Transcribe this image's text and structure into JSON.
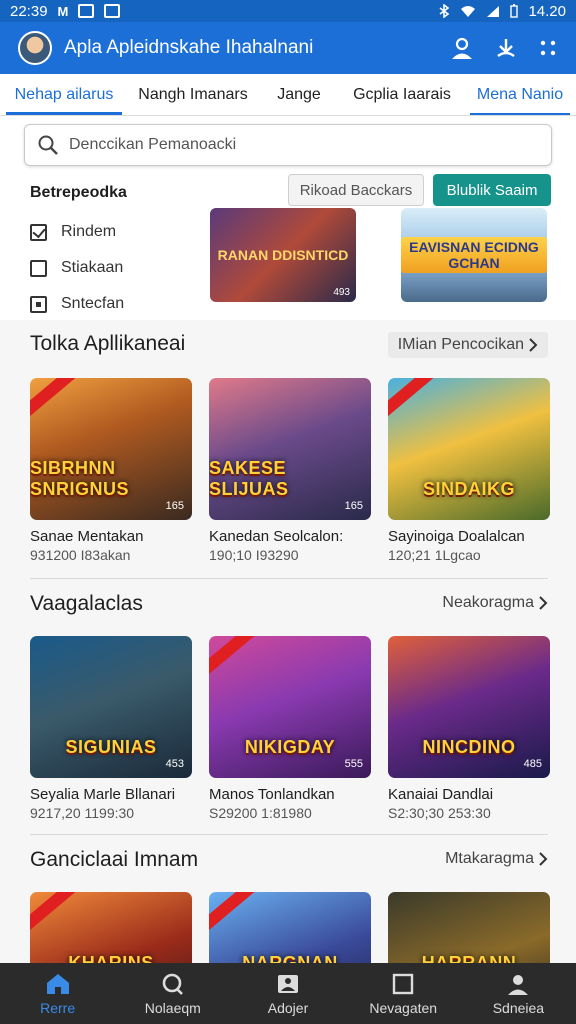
{
  "status_bar": {
    "time": "22:39",
    "left_icons": [
      "M",
      "photo-icon",
      "notification-icon"
    ],
    "right_time": "14.20"
  },
  "app_bar": {
    "title": "Apla Apleidnskahe Ihahalnani"
  },
  "tabs": [
    {
      "label": "Nehap ailarus",
      "active": true
    },
    {
      "label": "Nangh Imanars"
    },
    {
      "label": "Jange"
    },
    {
      "label": "Gcplia Iaarais"
    },
    {
      "label": "Mena Nanio"
    }
  ],
  "search": {
    "placeholder": "Denccikan Pemanoacki"
  },
  "filter": {
    "title": "Betrepeodka",
    "items": [
      {
        "label": "Rindem",
        "state": "checked"
      },
      {
        "label": "Stiakaan",
        "state": "unchecked"
      },
      {
        "label": "Sntecfan",
        "state": "indeterminate"
      }
    ],
    "secondary_button": "Rikoad Bacckars",
    "primary_button": "Blublik Saaim",
    "banners": [
      {
        "title": "RANAN DDISNTICD",
        "badge": "493"
      },
      {
        "title": "EAVISNAN ECIDNG GCHAN"
      }
    ]
  },
  "sections": [
    {
      "title": "Tolka Apllikaneai",
      "see_all": "IMian Pencocikan",
      "cards": [
        {
          "art": "SIBRHNN SNRIGNUS",
          "count": "165",
          "name": "Sanae Mentakan",
          "meta": "931200   I83akan"
        },
        {
          "art": "SAKESE SLIJUAS",
          "count": "165",
          "name": "Kanedan Seolcalon:",
          "meta": "190;10   I93290"
        },
        {
          "art": "SINDAIKG",
          "count": "",
          "name": "Sayinoiga Doalalcan",
          "meta": "120;21   1Lgcao"
        }
      ]
    },
    {
      "title": "Vaagalaclas",
      "see_all": "Neakoragma",
      "cards": [
        {
          "art": "SIGUNIAS",
          "count": "453",
          "name": "Seyalia Marle Bllanari",
          "meta": "9217,20   1199:30"
        },
        {
          "art": "NIKIGDAY",
          "count": "555",
          "name": "Manos Tonlandkan",
          "meta": "S29200   1:81980"
        },
        {
          "art": "NINCDINO",
          "count": "485",
          "name": "Kanaiai Dandlai",
          "meta": "S2:30;30   253:30"
        }
      ]
    },
    {
      "title": "Ganciclaai Imnam",
      "see_all": "Mtakaragma",
      "cards": [
        {
          "art": "KHARINS"
        },
        {
          "art": "NARGNAN"
        },
        {
          "art": "HARRANN"
        }
      ]
    }
  ],
  "bottom_nav": [
    {
      "label": "Rerre",
      "icon": "home-icon",
      "active": true
    },
    {
      "label": "Nolaeqm",
      "icon": "search-icon"
    },
    {
      "label": "Adojer",
      "icon": "gallery-icon"
    },
    {
      "label": "Nevagaten",
      "icon": "square-icon"
    },
    {
      "label": "Sdneiea",
      "icon": "profile-icon"
    }
  ],
  "colors": {
    "primary": "#1d6fd8",
    "teal_button": "#16948c",
    "bottom_nav": "#2b2b2b"
  }
}
